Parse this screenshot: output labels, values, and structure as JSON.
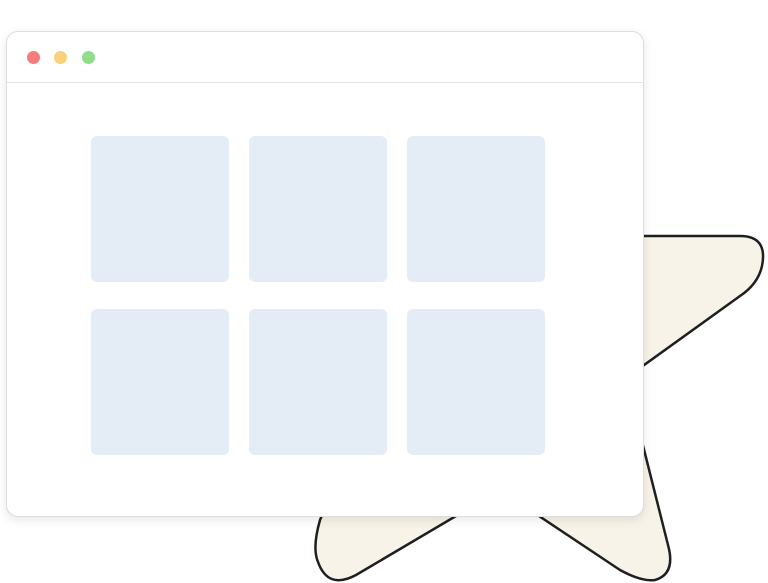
{
  "colors": {
    "page_background": "#ffffff",
    "window_background": "#ffffff",
    "window_border": "#dedede",
    "close_dot": "#f47c7c",
    "minimize_dot": "#fbd07a",
    "maximize_dot": "#8fdc8a",
    "tile_fill": "#e4ecf5",
    "star_fill": "#f8f3e8",
    "star_stroke": "#1f1f1f"
  },
  "window": {
    "controls": [
      "close",
      "minimize",
      "maximize"
    ],
    "grid": {
      "rows": 2,
      "columns": 3,
      "tiles": [
        {
          "row": 1,
          "col": 1
        },
        {
          "row": 1,
          "col": 2
        },
        {
          "row": 1,
          "col": 3
        },
        {
          "row": 2,
          "col": 1
        },
        {
          "row": 2,
          "col": 2
        },
        {
          "row": 2,
          "col": 3
        }
      ]
    }
  },
  "decoration": {
    "shape": "star-icon"
  }
}
